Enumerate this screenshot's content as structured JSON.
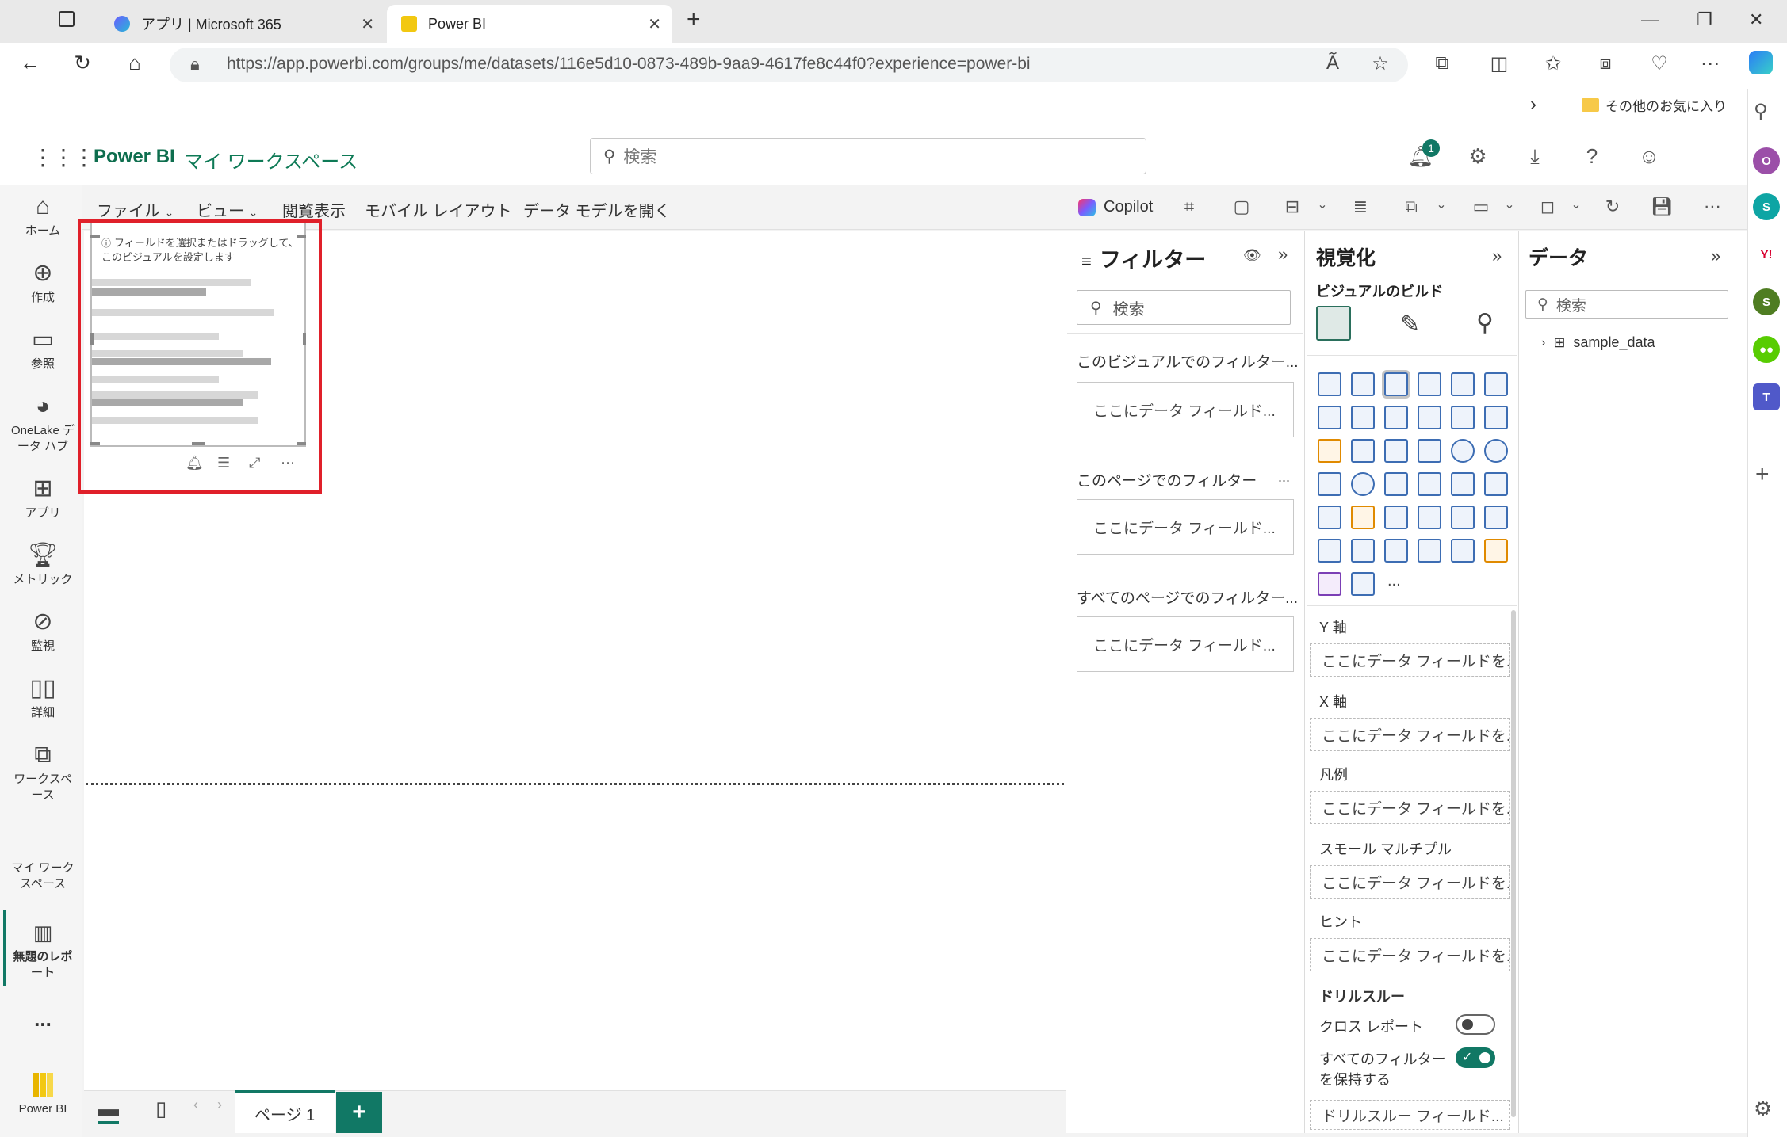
{
  "browser": {
    "tabs": [
      {
        "title": "アプリ | Microsoft 365"
      },
      {
        "title": "Power BI"
      }
    ],
    "url": "https://app.powerbi.com/groups/me/datasets/116e5d10-0873-489b-9aa9-4617fe8c44f0?experience=power-bi",
    "favorites_folder": "その他のお気に入り",
    "new_tab": "+"
  },
  "header": {
    "app_name": "Power BI",
    "workspace": "マイ ワークスペース",
    "search_placeholder": "検索",
    "notification_count": "1"
  },
  "leftnav": {
    "items": [
      {
        "label": "ホーム",
        "icon": "home-icon"
      },
      {
        "label": "作成",
        "icon": "create-icon"
      },
      {
        "label": "参照",
        "icon": "browse-icon"
      },
      {
        "label": "OneLake データ ハブ",
        "icon": "onelake-icon"
      },
      {
        "label": "アプリ",
        "icon": "apps-icon"
      },
      {
        "label": "メトリック",
        "icon": "metrics-icon"
      },
      {
        "label": "監視",
        "icon": "monitor-icon"
      },
      {
        "label": "詳細",
        "icon": "learn-icon"
      },
      {
        "label": "ワークスペース",
        "icon": "workspaces-icon"
      }
    ],
    "my_workspace": "マイ ワークスペース",
    "active_report": "無題のレポート",
    "more": "...",
    "footer": "Power BI"
  },
  "ribbon": {
    "file": "ファイル",
    "view": "ビュー",
    "reading_view": "閲覧表示",
    "mobile_layout": "モバイル レイアウト",
    "open_data_model": "データ モデルを開く",
    "copilot": "Copilot"
  },
  "canvas": {
    "visual_hint": "フィールドを選択またはドラッグして、このビジュアルを設定します"
  },
  "pages": {
    "tab_label": "ページ 1",
    "add": "+"
  },
  "filters": {
    "title": "フィルター",
    "search_placeholder": "検索",
    "sections": [
      {
        "title": "このビジュアルでのフィルター...",
        "well": "ここにデータ フィールド..."
      },
      {
        "title": "このページでのフィルター",
        "well": "ここにデータ フィールド..."
      },
      {
        "title": "すべてのページでのフィルター...",
        "well": "ここにデータ フィールド..."
      }
    ],
    "more": "..."
  },
  "visualizations": {
    "title": "視覚化",
    "build_label": "ビジュアルのビルド",
    "wells": [
      {
        "label": "Y 軸",
        "placeholder": "ここにデータ フィールドを..."
      },
      {
        "label": "X 軸",
        "placeholder": "ここにデータ フィールドを..."
      },
      {
        "label": "凡例",
        "placeholder": "ここにデータ フィールドを..."
      },
      {
        "label": "スモール マルチプル",
        "placeholder": "ここにデータ フィールドを..."
      },
      {
        "label": "ヒント",
        "placeholder": "ここにデータ フィールドを..."
      }
    ],
    "drillthrough": {
      "title": "ドリルスルー",
      "cross_report": "クロス レポート",
      "cross_report_on": false,
      "keep_filters_line1": "すべてのフィルター",
      "keep_filters_line2": "を保持する",
      "keep_filters_on": true,
      "well": "ドリルスルー フィールド..."
    },
    "more": "..."
  },
  "data": {
    "title": "データ",
    "search_placeholder": "検索",
    "tables": [
      {
        "name": "sample_data"
      }
    ]
  },
  "colors": {
    "accent": "#117865",
    "highlight": "#e0202a"
  }
}
